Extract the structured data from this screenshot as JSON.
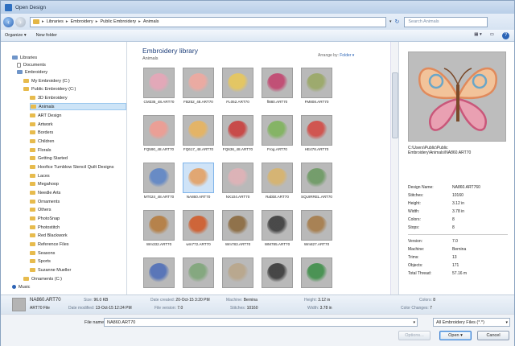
{
  "window": {
    "title": "Open Design"
  },
  "address": {
    "crumbs": [
      "Libraries",
      "Embroidery",
      "Public Embroidery",
      "Animals"
    ],
    "search_placeholder": "Search Animals"
  },
  "toolbar": {
    "organize_label": "Organize ▾",
    "new_folder_label": "New folder"
  },
  "nav": {
    "items": [
      {
        "label": "Libraries",
        "icon": "library-icon"
      },
      {
        "label": "Documents",
        "icon": "document-icon"
      },
      {
        "label": "Embroidery",
        "icon": "library-icon"
      },
      {
        "label": "My Embroidery (C:)",
        "icon": "folder-icon"
      },
      {
        "label": "Public Embroidery (C:)",
        "icon": "folder-icon"
      },
      {
        "label": "3D Embroidery",
        "icon": "folder-icon"
      },
      {
        "label": "Animals",
        "icon": "folder-icon"
      },
      {
        "label": "ART Design",
        "icon": "folder-icon"
      },
      {
        "label": "Artwork",
        "icon": "folder-icon"
      },
      {
        "label": "Borders",
        "icon": "folder-icon"
      },
      {
        "label": "Children",
        "icon": "folder-icon"
      },
      {
        "label": "Florals",
        "icon": "folder-icon"
      },
      {
        "label": "Getting Started",
        "icon": "folder-icon"
      },
      {
        "label": "Hoofice Tumblow Stencil Quilt Designs",
        "icon": "folder-icon"
      },
      {
        "label": "Laces",
        "icon": "folder-icon"
      },
      {
        "label": "Megahoop",
        "icon": "folder-icon"
      },
      {
        "label": "Needle Arts",
        "icon": "folder-icon"
      },
      {
        "label": "Ornaments",
        "icon": "folder-icon"
      },
      {
        "label": "Others",
        "icon": "folder-icon"
      },
      {
        "label": "PhotoSnap",
        "icon": "folder-icon"
      },
      {
        "label": "Photostitch",
        "icon": "folder-icon"
      },
      {
        "label": "Red Blackwork",
        "icon": "folder-icon"
      },
      {
        "label": "Reference Files",
        "icon": "folder-icon"
      },
      {
        "label": "Seasons",
        "icon": "folder-icon"
      },
      {
        "label": "Sports",
        "icon": "folder-icon"
      },
      {
        "label": "Suzanne Mueller",
        "icon": "folder-icon"
      },
      {
        "label": "Ornaments (C:)",
        "icon": "folder-icon"
      },
      {
        "label": "Music",
        "icon": "music-icon"
      }
    ]
  },
  "library": {
    "title": "Embroidery library",
    "subtitle": "Animals",
    "arrange_label": "Arrange by:",
    "arrange_value": "Folder ▾"
  },
  "files": [
    {
      "name": "CM335_48.ART70",
      "color": "#e6a6b8"
    },
    {
      "name": "FB252_48.ART70",
      "color": "#f0a9a0"
    },
    {
      "name": "FL052.ART70",
      "color": "#e8c75b"
    },
    {
      "name": "fl880.ART70",
      "color": "#c2456f"
    },
    {
      "name": "FM808.ART70",
      "color": "#9aa865"
    },
    {
      "name": "FQ590_48.ART70",
      "color": "#ef9c92"
    },
    {
      "name": "FQ617_48.ART70",
      "color": "#e8b45e"
    },
    {
      "name": "FQ636_48.ART70",
      "color": "#c93f3d"
    },
    {
      "name": "Frog.ART70",
      "color": "#7fb35c"
    },
    {
      "name": "HE478.ART70",
      "color": "#d24b45"
    },
    {
      "name": "MT024_48.ART70",
      "color": "#5f86c6"
    },
    {
      "name": "NA860.ART70",
      "color": "#e3a064"
    },
    {
      "name": "NX104.ART70",
      "color": "#e0b2b7"
    },
    {
      "name": "Rabbit.ART70",
      "color": "#d8b46c"
    },
    {
      "name": "SQUIRREL.ART70",
      "color": "#6d9a63"
    },
    {
      "name": "Wm332.ART70",
      "color": "#b57c3f"
    },
    {
      "name": "wm772.ART70",
      "color": "#d05c2b"
    },
    {
      "name": "Wm783.ART70",
      "color": "#8b6a3f"
    },
    {
      "name": "WM785.ART70",
      "color": "#3d3d3d"
    },
    {
      "name": "Wm827.ART70",
      "color": "#a67c4a"
    },
    {
      "name": "",
      "color": "#4f6fb8"
    },
    {
      "name": "",
      "color": "#7fa67a"
    },
    {
      "name": "",
      "color": "#b9a68a"
    },
    {
      "name": "",
      "color": "#3a3a3a"
    },
    {
      "name": "",
      "color": "#3f8f4a"
    }
  ],
  "preview": {
    "path": "C:\\Users\\Public\\Public Embroidery\\Animals\\NA860.ART70",
    "props": [
      {
        "k": "Design Name:",
        "v": "NA860.ART760"
      },
      {
        "k": "Stitches:",
        "v": "10160"
      },
      {
        "k": "Height:",
        "v": "3.12 in"
      },
      {
        "k": "Width:",
        "v": "3.78 in"
      },
      {
        "k": "Colors:",
        "v": "8"
      },
      {
        "k": "Stops:",
        "v": "8"
      }
    ],
    "props2": [
      {
        "k": "Version:",
        "v": "7.0"
      },
      {
        "k": "Machine:",
        "v": "Bernina"
      },
      {
        "k": "Trims:",
        "v": "13"
      },
      {
        "k": "Objects:",
        "v": "171"
      },
      {
        "k": "Total Thread:",
        "v": "57.16 m"
      }
    ]
  },
  "details": {
    "name": "NA860.ART70",
    "type": "ART70 File",
    "size_k": "Size:",
    "size_v": "96.0 KB",
    "modified_k": "Date modified:",
    "modified_v": "13-Oct-15 12:24 PM",
    "created_k": "Date created:",
    "created_v": "20-Oct-15 3:20 PM",
    "fileversion_k": "File version:",
    "fileversion_v": "7.0",
    "machine_k": "Machine:",
    "machine_v": "Bernina",
    "stitches_k": "Stitches:",
    "stitches_v": "10160",
    "height_k": "Height:",
    "height_v": "3.12 in",
    "width_k": "Width:",
    "width_v": "3.78 in",
    "colors_k": "Colors:",
    "colors_v": "8",
    "colorchanges_k": "Color Changes:",
    "colorchanges_v": "7"
  },
  "bottom": {
    "filename_label": "File name:",
    "filename_value": "NA860.ART70",
    "filter_value": "All Embroidery Files (*.*)",
    "options_label": "Options...",
    "open_label": "Open",
    "cancel_label": "Cancel"
  }
}
